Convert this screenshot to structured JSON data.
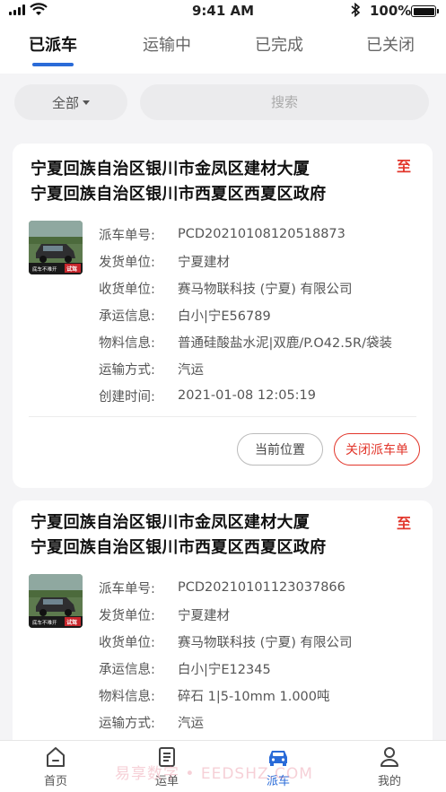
{
  "status_bar": {
    "time": "9:41 AM",
    "battery": "100%"
  },
  "tabs": [
    {
      "label": "已派车",
      "active": true
    },
    {
      "label": "运输中",
      "active": false
    },
    {
      "label": "已完成",
      "active": false
    },
    {
      "label": "已关闭",
      "active": false
    }
  ],
  "filter": {
    "select_value": "全部",
    "search_placeholder": "搜索"
  },
  "labels": {
    "order_no": "派车单号:",
    "shipper": "发货单位:",
    "receiver": "收货单位:",
    "carrier": "承运信息:",
    "material": "物料信息:",
    "transport": "运输方式:",
    "created": "创建时间:",
    "to": "至"
  },
  "cards": [
    {
      "from": "宁夏回族自治区银川市金凤区建材大厦",
      "dest": "宁夏回族自治区银川市西夏区西夏区政府",
      "order_no": "PCD20210108120518873",
      "shipper": "宁夏建材",
      "receiver": "赛马物联科技 (宁夏) 有限公司",
      "carrier": "白小|宁E56789",
      "material": "普通硅酸盐水泥|双鹿/P.O42.5R/袋装",
      "transport": "汽运",
      "created": "2021-01-08 12:05:19",
      "btn_location": "当前位置",
      "btn_close": "关闭派车单"
    },
    {
      "from": "宁夏回族自治区银川市金凤区建材大厦",
      "dest": "宁夏回族自治区银川市西夏区西夏区政府",
      "order_no": "PCD20210101123037866",
      "shipper": "宁夏建材",
      "receiver": "赛马物联科技 (宁夏) 有限公司",
      "carrier": "白小|宁E12345",
      "material": "碎石 1|5-10mm 1.000吨",
      "transport": "汽运"
    }
  ],
  "thumb_text": {
    "caption": "底车不难开",
    "badge": "试驾"
  },
  "bottom_nav": [
    {
      "label": "首页",
      "icon": "home-icon",
      "active": false
    },
    {
      "label": "运单",
      "icon": "waybill-icon",
      "active": false
    },
    {
      "label": "派车",
      "icon": "car-icon",
      "active": true
    },
    {
      "label": "我的",
      "icon": "user-icon",
      "active": false
    }
  ],
  "watermark": "易享数字 • EEDSHZ.COM",
  "colors": {
    "accent": "#2a6bd8",
    "danger": "#e2362b"
  }
}
